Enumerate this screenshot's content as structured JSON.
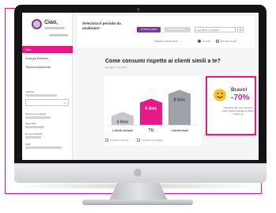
{
  "sidebar": {
    "greeting": "Ciao,",
    "nav": [
      "Gas",
      "Energia Elettrica",
      "Teleriscaldamento"
    ],
    "fields": [
      "Indirizzo",
      "Numero di contratto",
      "Superficie",
      "Numero abitanti",
      "Fogli"
    ]
  },
  "header": {
    "title": "Seleziona il periodo da analizzare:",
    "button_a": "ULTIMO ANNO",
    "button_b": "ULTIMO MESE",
    "range": "Lug 2018 - Giu 2019",
    "dropdown": "▾",
    "compare_label": "Mostra i miei consumi",
    "radio_a": "Annuali",
    "radio_b": "Mensili/periodo"
  },
  "main": {
    "heading": "Come consumi rispetto ai clienti simili a te?",
    "subtitle": "Lug 2018 - Giu 2019"
  },
  "chart_data": {
    "type": "bar",
    "categories": [
      "I clienti virtuosi",
      "TU",
      "I clienti medi"
    ],
    "series": [
      {
        "values": [
          3,
          6,
          8
        ]
      }
    ],
    "value_labels": [
      "3 Smc",
      "6 Smc",
      "8 Smc"
    ],
    "colors": [
      "#c5c8cd",
      "#e6198a",
      "#9ea2a8"
    ]
  },
  "comparison_card": {
    "title": "Bravo!",
    "value": "-70%",
    "description": "Complimenti! I tuoi consumi sono inferiori rispetto ai clienti simili a te"
  },
  "legend": [
    "Consumo stimato",
    "Consumo per adulto"
  ]
}
